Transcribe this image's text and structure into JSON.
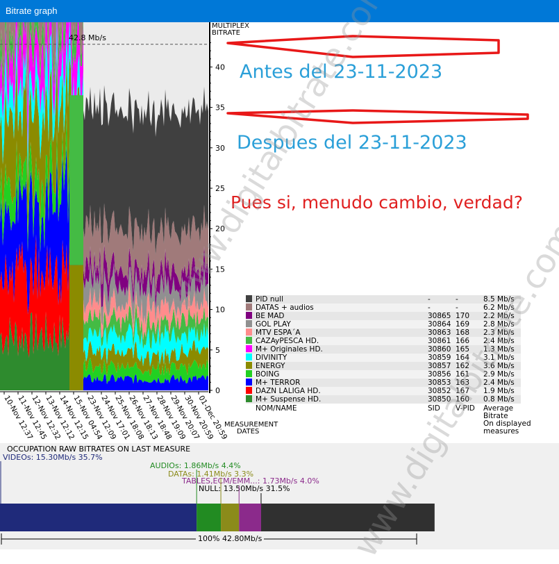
{
  "window": {
    "title": "Bitrate graph"
  },
  "chart_data": {
    "type": "area",
    "ylabel": "MULTIPLEX\nBITRATE",
    "ylim": [
      0,
      43
    ],
    "yticks": [
      0,
      5,
      10,
      15,
      20,
      25,
      30,
      35,
      40
    ],
    "max_label": "42.8 Mb/s",
    "xlabel": "MEASUREMENT\nDATES",
    "x_tick_labels": [
      "10-Nov 12:37",
      "11-Nov 12:45",
      "12-Nov 12:32",
      "13-Nov 12:12",
      "14-Nov 12:15",
      "15-Nov 04:54",
      "23-Nov 12:09",
      "24-Nov 17:01",
      "25-Nov 18:08",
      "26-Nov 18:13",
      "27-Nov 18:48",
      "28-Nov 19:09",
      "29-Nov 20:07",
      "30-Nov 20:59",
      "01-Dec 20:59"
    ],
    "series": [
      {
        "name": "M+ Suspense HD.",
        "color": "#2e8b2e",
        "sid": "30850",
        "vpid": "160",
        "avg": "0.8 Mb/s"
      },
      {
        "name": "DAZN LALIGA HD.",
        "color": "#ff0000",
        "sid": "30852",
        "vpid": "167",
        "avg": "1.9 Mb/s"
      },
      {
        "name": "M+ TERROR",
        "color": "#0000ff",
        "sid": "30853",
        "vpid": "163",
        "avg": "2.4 Mb/s"
      },
      {
        "name": "BOING",
        "color": "#22d022",
        "sid": "30856",
        "vpid": "161",
        "avg": "2.9 Mb/s"
      },
      {
        "name": "ENERGY",
        "color": "#8b8b00",
        "sid": "30857",
        "vpid": "162",
        "avg": "3.6 Mb/s"
      },
      {
        "name": "DIVINITY",
        "color": "#00ffff",
        "sid": "30859",
        "vpid": "164",
        "avg": "3.1 Mb/s"
      },
      {
        "name": "M+ Originales HD.",
        "color": "#ff00ff",
        "sid": "30860",
        "vpid": "165",
        "avg": "1.3 Mb/s"
      },
      {
        "name": "CAZAyPESCA HD.",
        "color": "#44bb44",
        "sid": "30861",
        "vpid": "166",
        "avg": "2.4 Mb/s"
      },
      {
        "name": "MTV ESPA´A",
        "color": "#ff8c8c",
        "sid": "30863",
        "vpid": "168",
        "avg": "2.3 Mb/s"
      },
      {
        "name": "GOL PLAY",
        "color": "#909090",
        "sid": "30864",
        "vpid": "169",
        "avg": "2.8 Mb/s"
      },
      {
        "name": "BE MAD",
        "color": "#800080",
        "sid": "30865",
        "vpid": "170",
        "avg": "2.2 Mb/s"
      },
      {
        "name": "DATAS + audios",
        "color": "#a07a7a",
        "sid": "-",
        "vpid": "-",
        "avg": "6.2 Mb/s"
      },
      {
        "name": "PID null",
        "color": "#404040",
        "sid": "-",
        "vpid": "-",
        "avg": "8.5 Mb/s"
      }
    ],
    "before": {
      "Suspense": 6.8,
      "DAZN": 8.0,
      "TERROR": 9.0,
      "BOING": 3.5,
      "ENERGY": 8.0,
      "DIVINITY": 4.0,
      "Originales": 4.5,
      "CAZAyPESCA": 2.5,
      "DATAS": 8.0,
      "PID null": 1.6
    },
    "after": {
      "Suspense": 0.0,
      "DAZN": 0.0,
      "TERROR": 1.4,
      "BOING": 1.5,
      "ENERGY": 1.8,
      "DIVINITY": 2.2,
      "Originales": 0.0,
      "CAZAyPESCA": 1.8,
      "MTV": 1.9,
      "GOL PLAY": 2.5,
      "BE MAD": 2.0,
      "DATAS": 5.1,
      "PID null": 14.6
    }
  },
  "legend_headers": {
    "name": "NOM/NAME",
    "sid": "SID",
    "vpid": "V-PID",
    "avg": "Average\nBitrate\nOn displayed\nmeasures"
  },
  "annotations": {
    "antes": "Antes del 23-11-2023",
    "despues": "Despues del 23-11-2023",
    "comment": "Pues si, menudo cambio, verdad?"
  },
  "watermark": "www.digitalbitrate.com",
  "occupation": {
    "title": "OCCUPATION RAW BITRATES ON LAST MEASURE",
    "videos": "VIDEOs: 15.30Mb/s  35.7%",
    "audios": "AUDIOs: 1.86Mb/s  4.4%",
    "datas": "DATAs: 1.41Mb/s  3.3%",
    "tables": "TABLES,ECM/EMM...: 1.73Mb/s  4.0%",
    "null": "NULL: 13.50Mb/s  31.5%",
    "total": "100%  42.80Mb/s",
    "segments": [
      {
        "name": "videos",
        "value": 35.7,
        "color": "#1f2a7a"
      },
      {
        "name": "audios",
        "value": 4.4,
        "color": "#228b22"
      },
      {
        "name": "datas",
        "value": 3.3,
        "color": "#8b8b1a"
      },
      {
        "name": "tables",
        "value": 4.0,
        "color": "#8b2a8b"
      },
      {
        "name": "null",
        "value": 31.5,
        "color": "#303030"
      }
    ],
    "colors": {
      "videos": "#1f2a7a",
      "audios": "#228b22",
      "datas": "#8b8b1a",
      "tables": "#8b2a8b",
      "null": "#000000"
    }
  }
}
